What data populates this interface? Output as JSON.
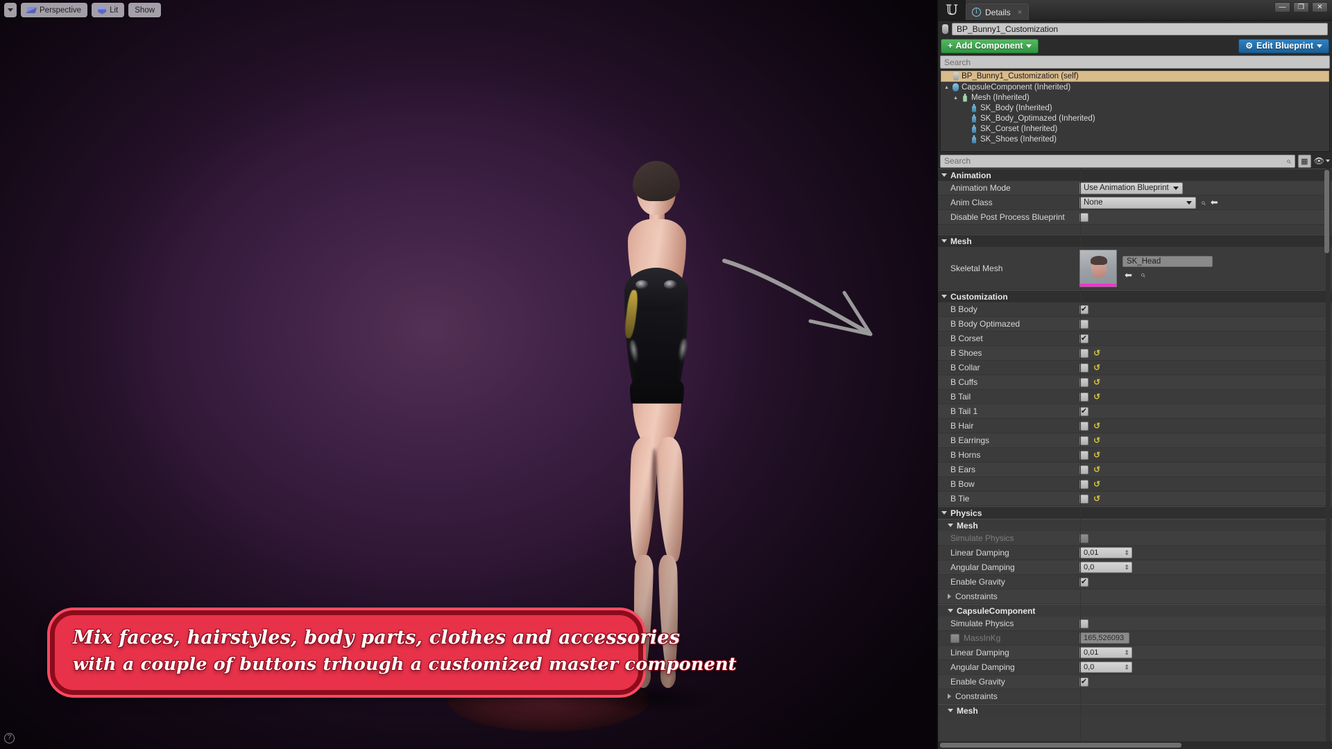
{
  "viewport": {
    "toolbar": {
      "caret_label": "▾",
      "perspective_label": "Perspective",
      "lit_label": "Lit",
      "show_label": "Show"
    },
    "help_label": "?"
  },
  "caption": {
    "line1": "Mix faces, hairstyles, body parts, clothes and accessories",
    "line2": "with a couple of buttons trhough a customized master component",
    "text_color": "#ffffff",
    "fill_color": "#e8324a",
    "border_color": "#8c0c1c",
    "glow_color": "#ff4a62"
  },
  "panel": {
    "titlebar": {
      "logo": "𝕌",
      "tab_label": "Details",
      "tab_icon": "i",
      "tab_close": "×",
      "window_minimize": "—",
      "window_maximize": "❐",
      "window_close": "✕"
    },
    "object_name": "BP_Bunny1_Customization",
    "add_component_label": "Add Component",
    "add_component_plus": "+",
    "edit_blueprint_label": "Edit Blueprint",
    "edit_blueprint_icon": "⚙",
    "tree_search_placeholder": "Search",
    "tree": [
      {
        "label": "BP_Bunny1_Customization (self)",
        "indent": 0,
        "selected": true,
        "twisty": "",
        "icon": "blueprint-icon"
      },
      {
        "label": "CapsuleComponent (Inherited)",
        "indent": 0,
        "selected": false,
        "twisty": "▴",
        "icon": "capsule-icon"
      },
      {
        "label": "Mesh (Inherited)",
        "indent": 1,
        "selected": false,
        "twisty": "▴",
        "icon": "pawn-icon"
      },
      {
        "label": "SK_Body (Inherited)",
        "indent": 2,
        "selected": false,
        "twisty": "",
        "icon": "skeletal-icon"
      },
      {
        "label": "SK_Body_Optimazed (Inherited)",
        "indent": 2,
        "selected": false,
        "twisty": "",
        "icon": "skeletal-icon"
      },
      {
        "label": "SK_Corset (Inherited)",
        "indent": 2,
        "selected": false,
        "twisty": "",
        "icon": "skeletal-icon"
      },
      {
        "label": "SK_Shoes (Inherited)",
        "indent": 2,
        "selected": false,
        "twisty": "",
        "icon": "skeletal-icon"
      }
    ],
    "details_search_placeholder": "Search",
    "details_search_icon": "⌕",
    "grid_view_icon": "▦",
    "eye_icon": "👁",
    "sections": {
      "animation": {
        "title": "Animation",
        "animation_mode_label": "Animation Mode",
        "animation_mode_value": "Use Animation Blueprint",
        "anim_class_label": "Anim Class",
        "anim_class_value": "None",
        "disable_post_process_label": "Disable Post Process Blueprint",
        "disable_post_process_checked": false
      },
      "mesh": {
        "title": "Mesh",
        "skeletal_mesh_label": "Skeletal Mesh",
        "skeletal_mesh_value": "SK_Head",
        "browse_icon": "⬅",
        "search_icon": "⌕"
      },
      "customization": {
        "title": "Customization",
        "rows": [
          {
            "label": "B Body",
            "checked": true,
            "reset": false
          },
          {
            "label": "B Body Optimazed",
            "checked": false,
            "reset": false
          },
          {
            "label": "B Corset",
            "checked": true,
            "reset": false
          },
          {
            "label": "B Shoes",
            "checked": false,
            "reset": true
          },
          {
            "label": "B Collar",
            "checked": false,
            "reset": true
          },
          {
            "label": "B Cuffs",
            "checked": false,
            "reset": true
          },
          {
            "label": "B Tail",
            "checked": false,
            "reset": true
          },
          {
            "label": "B Tail 1",
            "checked": true,
            "reset": false
          },
          {
            "label": "B Hair",
            "checked": false,
            "reset": true
          },
          {
            "label": "B Earrings",
            "checked": false,
            "reset": true
          },
          {
            "label": "B Horns",
            "checked": false,
            "reset": true
          },
          {
            "label": "B Ears",
            "checked": false,
            "reset": true
          },
          {
            "label": "B Bow",
            "checked": false,
            "reset": true
          },
          {
            "label": "B Tie",
            "checked": false,
            "reset": true
          }
        ],
        "reset_glyph": "↺"
      },
      "physics": {
        "title": "Physics",
        "groups": [
          {
            "title": "Mesh",
            "rows": [
              {
                "label": "Simulate Physics",
                "type": "checkbox",
                "checked": false,
                "disabled": true
              },
              {
                "label": "Linear Damping",
                "type": "number",
                "value": "0,01"
              },
              {
                "label": "Angular Damping",
                "type": "number",
                "value": "0,0"
              },
              {
                "label": "Enable Gravity",
                "type": "checkbox",
                "checked": true,
                "disabled": false
              },
              {
                "label": "Constraints",
                "type": "expander"
              }
            ]
          },
          {
            "title": "CapsuleComponent",
            "rows": [
              {
                "label": "Simulate Physics",
                "type": "checkbox",
                "checked": false,
                "disabled": false
              },
              {
                "label": "MassInKg",
                "type": "readonly",
                "value": "165,526093",
                "checked": false,
                "disabled": true
              },
              {
                "label": "Linear Damping",
                "type": "number",
                "value": "0,01"
              },
              {
                "label": "Angular Damping",
                "type": "number",
                "value": "0,0"
              },
              {
                "label": "Enable Gravity",
                "type": "checkbox",
                "checked": true,
                "disabled": false
              },
              {
                "label": "Constraints",
                "type": "expander"
              }
            ]
          },
          {
            "title": "Mesh",
            "rows": []
          }
        ]
      }
    }
  },
  "colors": {
    "panel_bg": "#2b2b2b",
    "row_bg": "#3b3b3b",
    "row_alt_bg": "#3f3f3f",
    "accent_green": "#2f9440",
    "accent_blue": "#1b5e94",
    "selection_tan": "#d9bb8c",
    "reset_yellow": "#d2c03c",
    "thumb_strip_magenta": "#ff2fd6"
  }
}
